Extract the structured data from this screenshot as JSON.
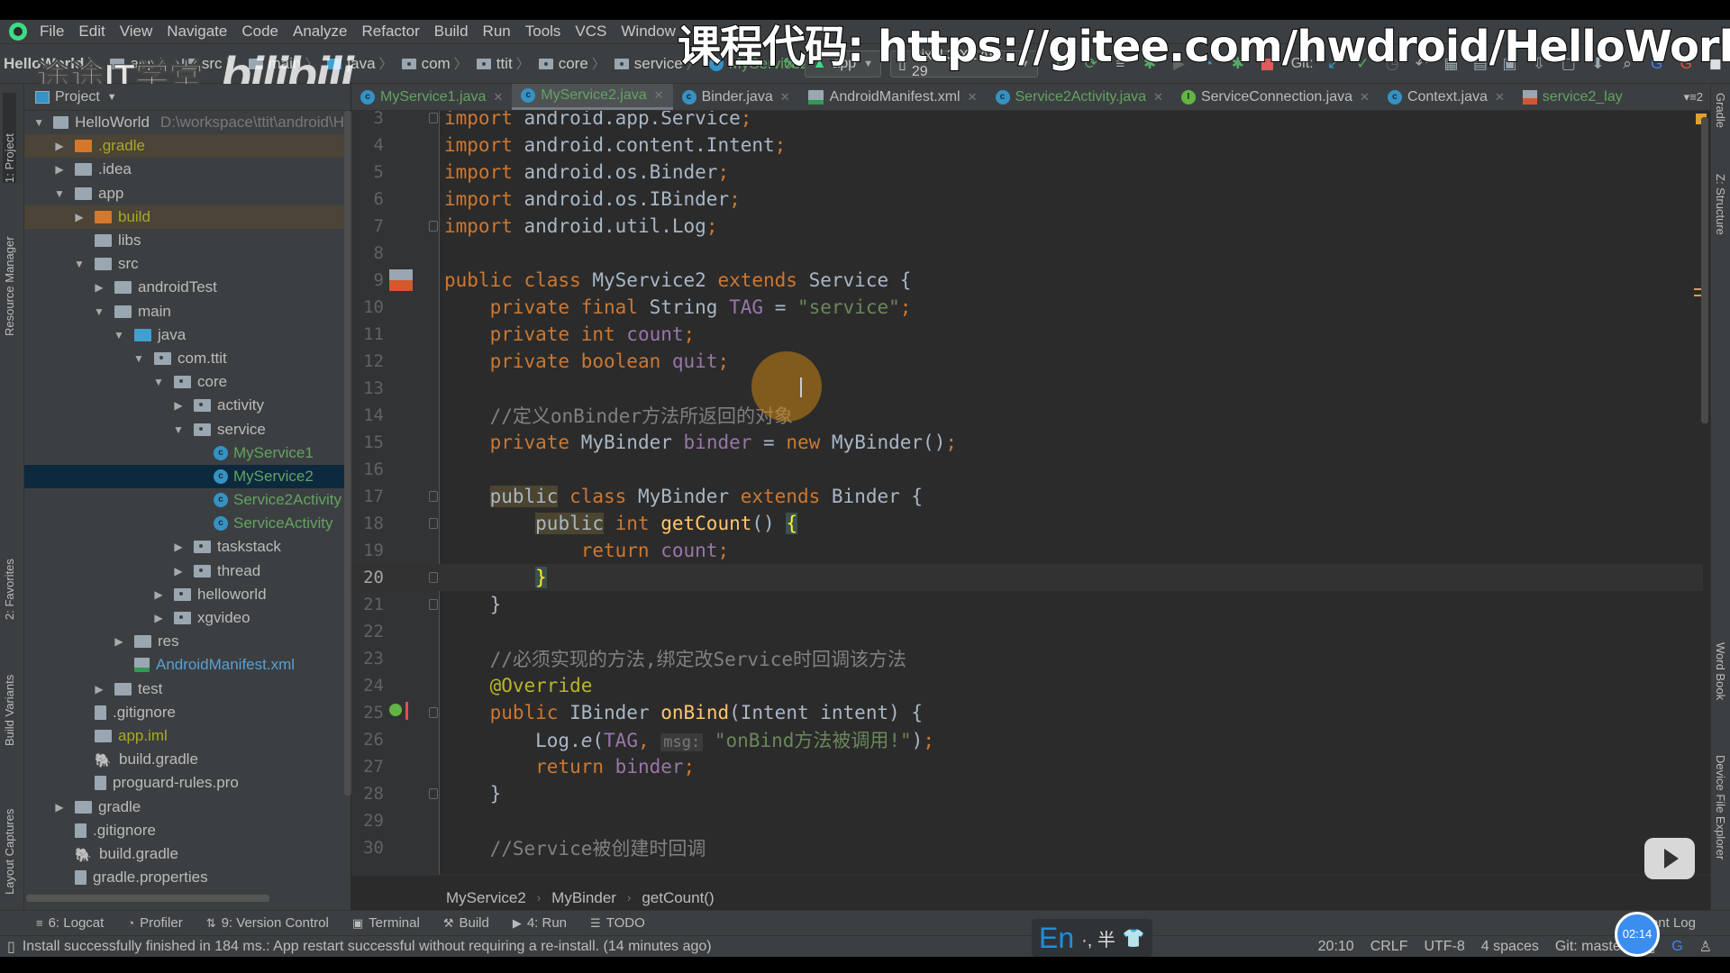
{
  "menu": {
    "items": [
      "File",
      "Edit",
      "View",
      "Navigate",
      "Code",
      "Analyze",
      "Refactor",
      "Build",
      "Run",
      "Tools",
      "VCS",
      "Window"
    ]
  },
  "navbar": {
    "crumbs": [
      "HelloWorld",
      "app",
      "src",
      "main",
      "java",
      "com",
      "ttit",
      "core",
      "service",
      "MyService2"
    ],
    "run_config": "app",
    "device": "Pixel 3 XL API 29",
    "git_label": "Git:"
  },
  "overlays": {
    "watermark_url": "课程代码: https://gitee.com/hwdroid/HelloWorld",
    "watermark_logo": "途途IT学堂",
    "watermark_bili": "bilibili"
  },
  "left_strip": {
    "tabs": [
      "1: Project",
      "Resource Manager",
      "2: Favorites",
      "Build Variants",
      "Layout Captures"
    ]
  },
  "right_strip": {
    "tabs": [
      "Gradle",
      "Z: Structure",
      "Word Book",
      "Device File Explorer"
    ]
  },
  "project_panel": {
    "title": "Project",
    "root_path": "D:\\workspace\\ttit\\android\\H",
    "tree": [
      {
        "label": "HelloWorld",
        "depth": 0,
        "arrow": "open",
        "icon": "module"
      },
      {
        "label": ".gradle",
        "depth": 1,
        "arrow": "closed",
        "icon": "folder-orange",
        "style": "olive",
        "hl": true
      },
      {
        "label": ".idea",
        "depth": 1,
        "arrow": "closed",
        "icon": "folder"
      },
      {
        "label": "app",
        "depth": 1,
        "arrow": "open",
        "icon": "folder"
      },
      {
        "label": "build",
        "depth": 2,
        "arrow": "closed",
        "icon": "folder-orange",
        "style": "olive",
        "hl": true
      },
      {
        "label": "libs",
        "depth": 2,
        "arrow": "none",
        "icon": "folder"
      },
      {
        "label": "src",
        "depth": 2,
        "arrow": "open",
        "icon": "folder"
      },
      {
        "label": "androidTest",
        "depth": 3,
        "arrow": "closed",
        "icon": "folder"
      },
      {
        "label": "main",
        "depth": 3,
        "arrow": "open",
        "icon": "folder"
      },
      {
        "label": "java",
        "depth": 4,
        "arrow": "open",
        "icon": "folder-blue"
      },
      {
        "label": "com.ttit",
        "depth": 5,
        "arrow": "open",
        "icon": "package"
      },
      {
        "label": "core",
        "depth": 6,
        "arrow": "open",
        "icon": "package"
      },
      {
        "label": "activity",
        "depth": 7,
        "arrow": "closed",
        "icon": "package"
      },
      {
        "label": "service",
        "depth": 7,
        "arrow": "open",
        "icon": "package"
      },
      {
        "label": "MyService1",
        "depth": 8,
        "arrow": "none",
        "icon": "class",
        "style": "green"
      },
      {
        "label": "MyService2",
        "depth": 8,
        "arrow": "none",
        "icon": "class",
        "style": "green",
        "sel": true
      },
      {
        "label": "Service2Activity",
        "depth": 8,
        "arrow": "none",
        "icon": "class",
        "style": "green"
      },
      {
        "label": "ServiceActivity",
        "depth": 8,
        "arrow": "none",
        "icon": "class",
        "style": "green"
      },
      {
        "label": "taskstack",
        "depth": 7,
        "arrow": "closed",
        "icon": "package"
      },
      {
        "label": "thread",
        "depth": 7,
        "arrow": "closed",
        "icon": "package"
      },
      {
        "label": "helloworld",
        "depth": 6,
        "arrow": "closed",
        "icon": "package"
      },
      {
        "label": "xgvideo",
        "depth": 6,
        "arrow": "closed",
        "icon": "package"
      },
      {
        "label": "res",
        "depth": 4,
        "arrow": "closed",
        "icon": "folder"
      },
      {
        "label": "AndroidManifest.xml",
        "depth": 4,
        "arrow": "none",
        "icon": "manifest",
        "style": "blue"
      },
      {
        "label": "test",
        "depth": 3,
        "arrow": "closed",
        "icon": "folder"
      },
      {
        "label": ".gitignore",
        "depth": 2,
        "arrow": "none",
        "icon": "file"
      },
      {
        "label": "app.iml",
        "depth": 2,
        "arrow": "none",
        "icon": "folder",
        "style": "olive"
      },
      {
        "label": "build.gradle",
        "depth": 2,
        "arrow": "none",
        "icon": "gradle"
      },
      {
        "label": "proguard-rules.pro",
        "depth": 2,
        "arrow": "none",
        "icon": "file"
      },
      {
        "label": "gradle",
        "depth": 1,
        "arrow": "closed",
        "icon": "folder"
      },
      {
        "label": ".gitignore",
        "depth": 1,
        "arrow": "none",
        "icon": "file"
      },
      {
        "label": "build.gradle",
        "depth": 1,
        "arrow": "none",
        "icon": "gradle"
      },
      {
        "label": "gradle.properties",
        "depth": 1,
        "arrow": "none",
        "icon": "file"
      }
    ]
  },
  "editor_tabs": [
    {
      "label": "MyService1.java",
      "icon": "class",
      "green": true
    },
    {
      "label": "MyService2.java",
      "icon": "class",
      "green": true,
      "active": true
    },
    {
      "label": "Binder.java",
      "icon": "class"
    },
    {
      "label": "AndroidManifest.xml",
      "icon": "manifest"
    },
    {
      "label": "Service2Activity.java",
      "icon": "class",
      "green": true
    },
    {
      "label": "ServiceConnection.java",
      "icon": "interface"
    },
    {
      "label": "Context.java",
      "icon": "class"
    },
    {
      "label": "service2_lay",
      "icon": "layout",
      "green": true
    }
  ],
  "tab_overflow": "2",
  "editor": {
    "current_line": 20,
    "lines": [
      {
        "n": 3,
        "tokens": [
          [
            "kw",
            "import "
          ],
          [
            "",
            "android.app.Service"
          ],
          [
            "kw",
            ";"
          ]
        ]
      },
      {
        "n": 4,
        "tokens": [
          [
            "kw",
            "import "
          ],
          [
            "",
            "android.content.Intent"
          ],
          [
            "kw",
            ";"
          ]
        ]
      },
      {
        "n": 5,
        "tokens": [
          [
            "kw",
            "import "
          ],
          [
            "",
            "android.os.Binder"
          ],
          [
            "kw",
            ";"
          ]
        ]
      },
      {
        "n": 6,
        "tokens": [
          [
            "kw",
            "import "
          ],
          [
            "",
            "android.os.IBinder"
          ],
          [
            "kw",
            ";"
          ]
        ]
      },
      {
        "n": 7,
        "tokens": [
          [
            "kw",
            "import "
          ],
          [
            "",
            "android.util.Log"
          ],
          [
            "kw",
            ";"
          ]
        ]
      },
      {
        "n": 8,
        "tokens": []
      },
      {
        "n": 9,
        "tokens": [
          [
            "kw",
            "public class "
          ],
          [
            "",
            "MyService2 "
          ],
          [
            "kw",
            "extends "
          ],
          [
            "",
            "Service {"
          ]
        ]
      },
      {
        "n": 10,
        "tokens": [
          [
            "",
            "    "
          ],
          [
            "kw",
            "private final "
          ],
          [
            "",
            "String "
          ],
          [
            "fld",
            "TAG"
          ],
          [
            "",
            " = "
          ],
          [
            "str",
            "\"service\""
          ],
          [
            "kw",
            ";"
          ]
        ]
      },
      {
        "n": 11,
        "tokens": [
          [
            "",
            "    "
          ],
          [
            "kw",
            "private int "
          ],
          [
            "fld",
            "count"
          ],
          [
            "kw",
            ";"
          ]
        ]
      },
      {
        "n": 12,
        "tokens": [
          [
            "",
            "    "
          ],
          [
            "kw",
            "private boolean "
          ],
          [
            "fld",
            "quit"
          ],
          [
            "kw",
            ";"
          ]
        ]
      },
      {
        "n": 13,
        "tokens": []
      },
      {
        "n": 14,
        "tokens": [
          [
            "",
            "    "
          ],
          [
            "cmt",
            "//定义onBinder方法所返回的对象"
          ]
        ]
      },
      {
        "n": 15,
        "tokens": [
          [
            "",
            "    "
          ],
          [
            "kw",
            "private "
          ],
          [
            "",
            "MyBinder "
          ],
          [
            "fld",
            "binder"
          ],
          [
            "",
            " = "
          ],
          [
            "kw",
            "new "
          ],
          [
            "",
            "MyBinder()"
          ],
          [
            "kw",
            ";"
          ]
        ]
      },
      {
        "n": 16,
        "tokens": []
      },
      {
        "n": 17,
        "tokens": [
          [
            "",
            "    "
          ],
          [
            "kwhl",
            "public"
          ],
          [
            "kw",
            " class "
          ],
          [
            "",
            "MyBinder "
          ],
          [
            "kw",
            "extends "
          ],
          [
            "",
            "Binder {"
          ]
        ]
      },
      {
        "n": 18,
        "tokens": [
          [
            "",
            "        "
          ],
          [
            "kwhl",
            "public"
          ],
          [
            "kw",
            " int "
          ],
          [
            "fn",
            "getCount"
          ],
          [
            "",
            "() "
          ],
          [
            "bracehl",
            "{"
          ]
        ]
      },
      {
        "n": 19,
        "tokens": [
          [
            "",
            "            "
          ],
          [
            "kw",
            "return "
          ],
          [
            "fld",
            "count"
          ],
          [
            "kw",
            ";"
          ]
        ]
      },
      {
        "n": 20,
        "tokens": [
          [
            "",
            "        "
          ],
          [
            "bracehl",
            "}"
          ]
        ]
      },
      {
        "n": 21,
        "tokens": [
          [
            "",
            "    }"
          ]
        ]
      },
      {
        "n": 22,
        "tokens": []
      },
      {
        "n": 23,
        "tokens": [
          [
            "",
            "    "
          ],
          [
            "cmt",
            "//必须实现的方法,绑定改Service时回调该方法"
          ]
        ]
      },
      {
        "n": 24,
        "tokens": [
          [
            "",
            "    "
          ],
          [
            "ann",
            "@Override"
          ]
        ]
      },
      {
        "n": 25,
        "tokens": [
          [
            "",
            "    "
          ],
          [
            "kw",
            "public "
          ],
          [
            "",
            "IBinder "
          ],
          [
            "fn",
            "onBind"
          ],
          [
            "",
            "(Intent intent) {"
          ]
        ]
      },
      {
        "n": 26,
        "tokens": [
          [
            "",
            "        Log."
          ],
          [
            "fnit",
            "e"
          ],
          [
            "",
            "("
          ],
          [
            "fld",
            "TAG"
          ],
          [
            "kw",
            ", "
          ],
          [
            "hint",
            "msg:"
          ],
          [
            "",
            " "
          ],
          [
            "str",
            "\"onBind方法被调用!\""
          ],
          [
            "",
            ")"
          ],
          [
            "kw",
            ";"
          ]
        ]
      },
      {
        "n": 27,
        "tokens": [
          [
            "",
            "        "
          ],
          [
            "kw",
            "return "
          ],
          [
            "fld",
            "binder"
          ],
          [
            "kw",
            ";"
          ]
        ]
      },
      {
        "n": 28,
        "tokens": [
          [
            "",
            "    }"
          ]
        ]
      },
      {
        "n": 29,
        "tokens": []
      },
      {
        "n": 30,
        "tokens": [
          [
            "",
            "    "
          ],
          [
            "cmt",
            "//Service被创建时回调"
          ]
        ]
      }
    ]
  },
  "editor_breadcrumbs": [
    "MyService2",
    "MyBinder",
    "getCount()"
  ],
  "bottom_tools": [
    {
      "label": "6: Logcat",
      "icon": "≡"
    },
    {
      "label": "Profiler",
      "icon": "◔"
    },
    {
      "label": "9: Version Control",
      "icon": "⇅"
    },
    {
      "label": "Terminal",
      "icon": "▣"
    },
    {
      "label": "Build",
      "icon": "⚒"
    },
    {
      "label": "4: Run",
      "icon": "▶"
    },
    {
      "label": "TODO",
      "icon": "☰"
    }
  ],
  "event_log": "Event Log",
  "status": {
    "message": "Install successfully finished in 184 ms.: App restart successful without requiring a re-install. (14 minutes ago)",
    "position": "20:10",
    "line_sep": "CRLF",
    "encoding": "UTF-8",
    "indent": "4 spaces",
    "git_branch": "Git: master"
  },
  "ime": {
    "lang": "En",
    "extra": "·, 半"
  },
  "timer": "02:14"
}
